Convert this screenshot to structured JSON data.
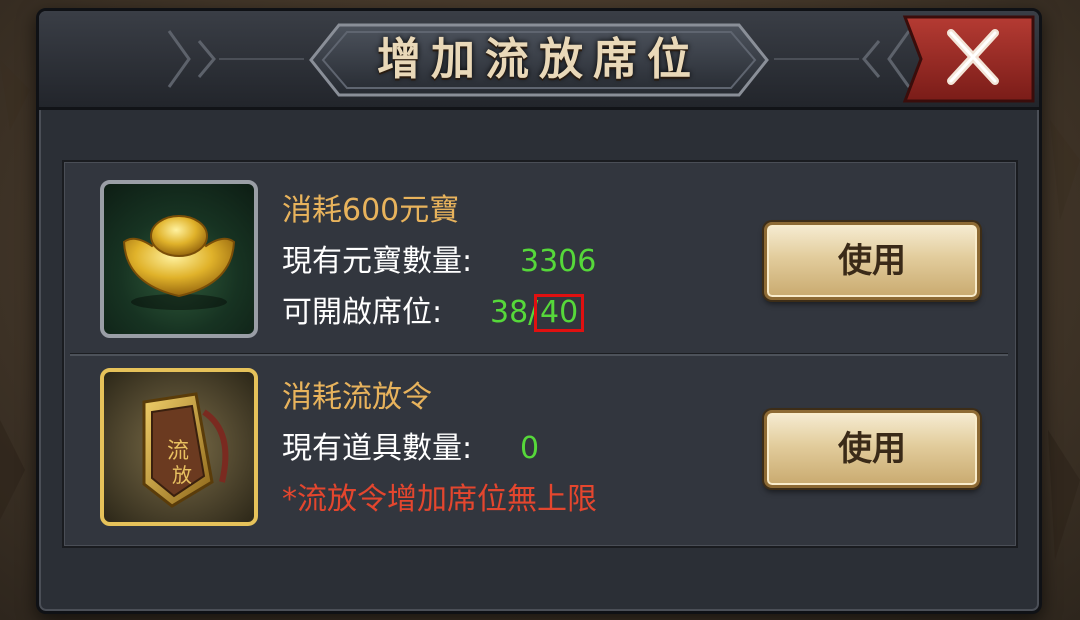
{
  "dialog": {
    "title": "增加流放席位",
    "close_icon": "close-x-icon"
  },
  "option_ingot": {
    "icon": "gold-ingot-icon",
    "cost_label": "消耗600元寶",
    "owned_label": "現有元寶數量:",
    "owned_value": "3306",
    "seats_label": "可開啟席位:",
    "seats_current": "38/",
    "seats_max": "40",
    "button_label": "使用"
  },
  "option_token": {
    "icon": "exile-token-icon",
    "cost_label": "消耗流放令",
    "owned_label": "現有道具數量:",
    "owned_value": "0",
    "note": "*流放令增加席位無上限",
    "button_label": "使用"
  },
  "colors": {
    "label_gold": "#e8b35c",
    "value_green": "#56d83a",
    "note_red": "#e4462e",
    "highlight_red": "#e01010"
  }
}
